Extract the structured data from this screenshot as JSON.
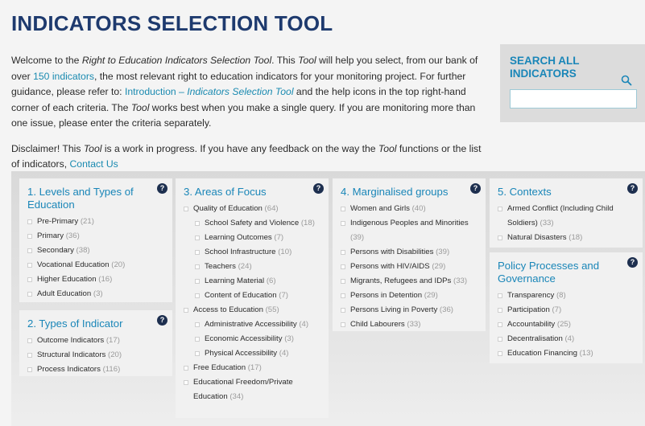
{
  "title": "INDICATORS SELECTION TOOL",
  "intro": {
    "p1": {
      "t1": "Welcome to the ",
      "tool_name": "Right to Education Indicators Selection Tool",
      "t2": ". This ",
      "tool_word": "Tool",
      "t3": " will help you select, from our bank of over ",
      "link_150": "150 indicators",
      "t4": ", the most relevant right to education indicators for your monitoring project. For further guidance, please refer to: ",
      "link_intro": "Introduction – ",
      "link_intro_italic": "Indicators Selection Tool",
      "t5": " and the help icons in the top right-hand corner of each criteria. The ",
      "tool_word2": "Tool",
      "t6": " works best when you make a single query. If you are monitoring more than one issue, please enter the criteria separately."
    },
    "p2": {
      "t1": "Disclaimer! This ",
      "tool_word": "Tool",
      "t2": " is a work in progress. If you have any feedback on the way the ",
      "tool_word2": "Tool",
      "t3": " functions or the list of indicators, ",
      "link_contact": "Contact Us"
    }
  },
  "search": {
    "title": "SEARCH ALL INDICATORS",
    "placeholder": "",
    "icon": "magnifier-icon"
  },
  "help_glyph": "?",
  "col1": {
    "levels": {
      "title": "1. Levels and Types of Education",
      "items": [
        {
          "label": "Pre-Primary",
          "count": "(21)"
        },
        {
          "label": "Primary",
          "count": "(36)"
        },
        {
          "label": "Secondary",
          "count": "(38)"
        },
        {
          "label": "Vocational Education",
          "count": "(20)"
        },
        {
          "label": "Higher Education",
          "count": "(16)"
        },
        {
          "label": "Adult Education",
          "count": "(3)"
        }
      ]
    },
    "types": {
      "title": "2. Types of Indicator",
      "items": [
        {
          "label": "Outcome Indicators",
          "count": "(17)"
        },
        {
          "label": "Structural Indicators",
          "count": "(20)"
        },
        {
          "label": "Process Indicators",
          "count": "(116)"
        }
      ]
    }
  },
  "col2": {
    "title": "3. Areas of Focus",
    "items": [
      {
        "label": "Quality of Education",
        "count": "(64)",
        "sub": false
      },
      {
        "label": "School Safety and Violence",
        "count": "(18)",
        "sub": true
      },
      {
        "label": "Learning Outcomes",
        "count": "(7)",
        "sub": true
      },
      {
        "label": "School Infrastructure",
        "count": "(10)",
        "sub": true
      },
      {
        "label": "Teachers",
        "count": "(24)",
        "sub": true
      },
      {
        "label": "Learning Material",
        "count": "(6)",
        "sub": true
      },
      {
        "label": "Content of Education",
        "count": "(7)",
        "sub": true
      },
      {
        "label": "Access to Education",
        "count": "(55)",
        "sub": false
      },
      {
        "label": "Administrative Accessibility",
        "count": "(4)",
        "sub": true
      },
      {
        "label": "Economic Accessibility",
        "count": "(3)",
        "sub": true
      },
      {
        "label": "Physical Accessibility",
        "count": "(4)",
        "sub": true
      },
      {
        "label": "Free Education",
        "count": "(17)",
        "sub": false
      },
      {
        "label": "Educational Freedom/Private Education",
        "count": "(34)",
        "sub": false
      }
    ]
  },
  "col3": {
    "title": "4. Marginalised groups",
    "items": [
      {
        "label": "Women and Girls",
        "count": "(40)"
      },
      {
        "label": "Indigenous Peoples and Minorities",
        "count": "(39)"
      },
      {
        "label": "Persons with Disabilities",
        "count": "(39)"
      },
      {
        "label": "Persons with HIV/AIDS",
        "count": "(29)"
      },
      {
        "label": "Migrants, Refugees and IDPs",
        "count": "(33)"
      },
      {
        "label": "Persons in Detention",
        "count": "(29)"
      },
      {
        "label": "Persons Living in Poverty",
        "count": "(36)"
      },
      {
        "label": "Child Labourers",
        "count": "(33)"
      }
    ]
  },
  "col4": {
    "contexts": {
      "title": "5. Contexts",
      "items": [
        {
          "label": "Armed Conflict (Including Child Soldiers)",
          "count": "(33)"
        },
        {
          "label": "Natural Disasters",
          "count": "(18)"
        }
      ]
    },
    "policy": {
      "title": "Policy Processes and Governance",
      "items": [
        {
          "label": "Transparency",
          "count": "(8)"
        },
        {
          "label": "Participation",
          "count": "(7)"
        },
        {
          "label": "Accountability",
          "count": "(25)"
        },
        {
          "label": "Decentralisation",
          "count": "(4)"
        },
        {
          "label": "Education Financing",
          "count": "(13)"
        }
      ]
    }
  }
}
